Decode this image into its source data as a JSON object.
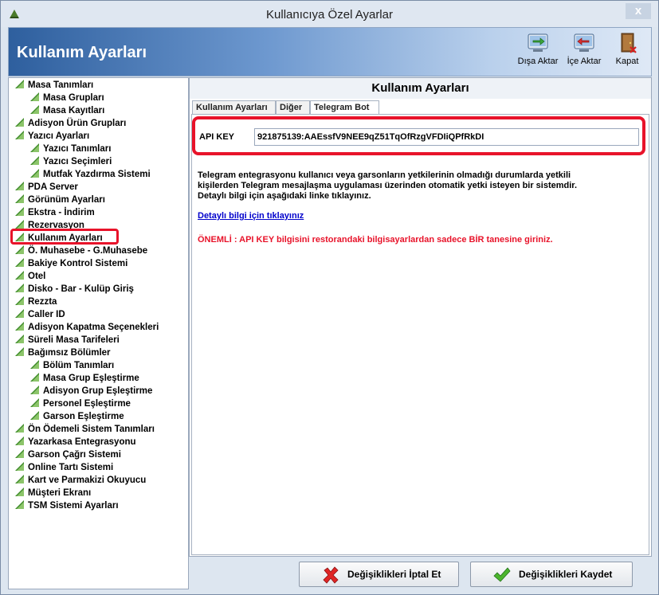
{
  "window": {
    "title": "Kullanıcıya Özel Ayarlar",
    "close_label": "x"
  },
  "banner": {
    "title": "Kullanım Ayarları"
  },
  "toolbar": {
    "export_label": "Dışa Aktar",
    "import_label": "İçe Aktar",
    "close_label": "Kapat"
  },
  "tree": {
    "items": [
      {
        "label": "Masa Tanımları",
        "level": 0
      },
      {
        "label": "Masa Grupları",
        "level": 1
      },
      {
        "label": "Masa Kayıtları",
        "level": 1
      },
      {
        "label": "Adisyon Ürün Grupları",
        "level": 0
      },
      {
        "label": "Yazıcı Ayarları",
        "level": 0
      },
      {
        "label": "Yazıcı Tanımları",
        "level": 1
      },
      {
        "label": "Yazıcı Seçimleri",
        "level": 1
      },
      {
        "label": "Mutfak Yazdırma Sistemi",
        "level": 1
      },
      {
        "label": "PDA Server",
        "level": 0
      },
      {
        "label": "Görünüm Ayarları",
        "level": 0
      },
      {
        "label": "Ekstra - İndirim",
        "level": 0
      },
      {
        "label": "Rezervasyon",
        "level": 0
      },
      {
        "label": "Kullanım Ayarları",
        "level": 0,
        "selected": true
      },
      {
        "label": "Ö. Muhasebe - G.Muhasebe",
        "level": 0
      },
      {
        "label": "Bakiye Kontrol Sistemi",
        "level": 0
      },
      {
        "label": "Otel",
        "level": 0
      },
      {
        "label": "Disko - Bar - Kulüp Giriş",
        "level": 0
      },
      {
        "label": "Rezzta",
        "level": 0
      },
      {
        "label": "Caller ID",
        "level": 0
      },
      {
        "label": "Adisyon Kapatma Seçenekleri",
        "level": 0
      },
      {
        "label": "Süreli Masa Tarifeleri",
        "level": 0
      },
      {
        "label": "Bağımsız Bölümler",
        "level": 0
      },
      {
        "label": "Bölüm Tanımları",
        "level": 1
      },
      {
        "label": "Masa Grup Eşleştirme",
        "level": 1
      },
      {
        "label": "Adisyon Grup Eşleştirme",
        "level": 1
      },
      {
        "label": "Personel Eşleştirme",
        "level": 1
      },
      {
        "label": "Garson Eşleştirme",
        "level": 1
      },
      {
        "label": "Ön Ödemeli Sistem Tanımları",
        "level": 0
      },
      {
        "label": "Yazarkasa Entegrasyonu",
        "level": 0
      },
      {
        "label": "Garson Çağrı Sistemi",
        "level": 0
      },
      {
        "label": "Online Tartı Sistemi",
        "level": 0
      },
      {
        "label": "Kart ve Parmakizi Okuyucu",
        "level": 0
      },
      {
        "label": "Müşteri Ekranı",
        "level": 0
      },
      {
        "label": "TSM Sistemi Ayarları",
        "level": 0
      }
    ]
  },
  "panel": {
    "title": "Kullanım Ayarları",
    "tabs": [
      {
        "label": "Kullanım Ayarları",
        "active": false
      },
      {
        "label": "Diğer",
        "active": false
      },
      {
        "label": "Telegram Bot",
        "active": true
      }
    ],
    "api_key_label": "API KEY",
    "api_key_value": "921875139:AAEssfV9NEE9qZ51TqOfRzgVFDIiQPfRkDI",
    "info_lines": [
      "Telegram entegrasyonu kullanıcı veya garsonların yetkilerinin olmadığı durumlarda yetkili",
      "kişilerden Telegram mesajlaşma uygulaması üzerinden otomatik yetki isteyen bir sistemdir.",
      "Detaylı bilgi için aşağıdaki linke tıklayınız."
    ],
    "link_text": "Detaylı bilgi için tıklayınız",
    "warning": "ÖNEMLİ : API KEY bilgisini restorandaki bilgisayarlardan sadece BİR tanesine giriniz."
  },
  "actions": {
    "cancel_label": "Değişiklikleri İptal Et",
    "save_label": "Değişiklikleri Kaydet"
  },
  "colors": {
    "highlight_red": "#e8132a",
    "leaf_green": "#3f8a2a",
    "banner_blue": "#2e5f9e"
  }
}
